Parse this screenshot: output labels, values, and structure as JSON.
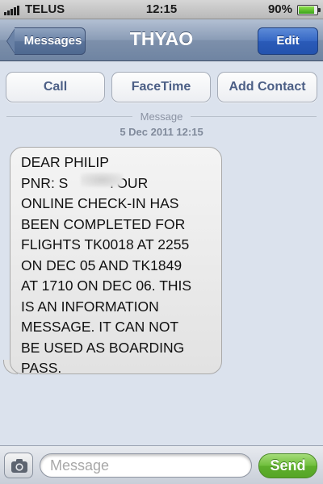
{
  "status_bar": {
    "carrier": "TELUS",
    "time": "12:15",
    "battery_percent": "90%",
    "battery_level": 0.9
  },
  "nav": {
    "back_label": "Messages",
    "title": "THYAO",
    "edit_label": "Edit"
  },
  "actions": {
    "call_label": "Call",
    "facetime_label": "FaceTime",
    "add_contact_label": "Add Contact"
  },
  "thread": {
    "separator_label": "Message",
    "timestamp": "5 Dec 2011 12:15",
    "messages": [
      {
        "text": "DEAR PHILIP\nPNR: S          YOUR\nONLINE CHECK-IN HAS\nBEEN COMPLETED FOR\nFLIGHTS TK0018 AT 2255\nON DEC 05 AND TK1849\nAT 1710 ON DEC 06. THIS\nIS AN INFORMATION\nMESSAGE. IT CAN NOT\nBE USED AS BOARDING\nPASS."
      }
    ]
  },
  "composer": {
    "placeholder": "Message",
    "send_label": "Send"
  },
  "colors": {
    "nav_bar": "#7d90ab",
    "edit_button": "#2a5ab8",
    "send_button": "#5eaf2c",
    "background": "#dbe2ed"
  },
  "icons": {
    "back": "chevron-left-button",
    "camera": "camera-icon",
    "signal": "signal-bars-icon",
    "battery": "battery-icon"
  }
}
